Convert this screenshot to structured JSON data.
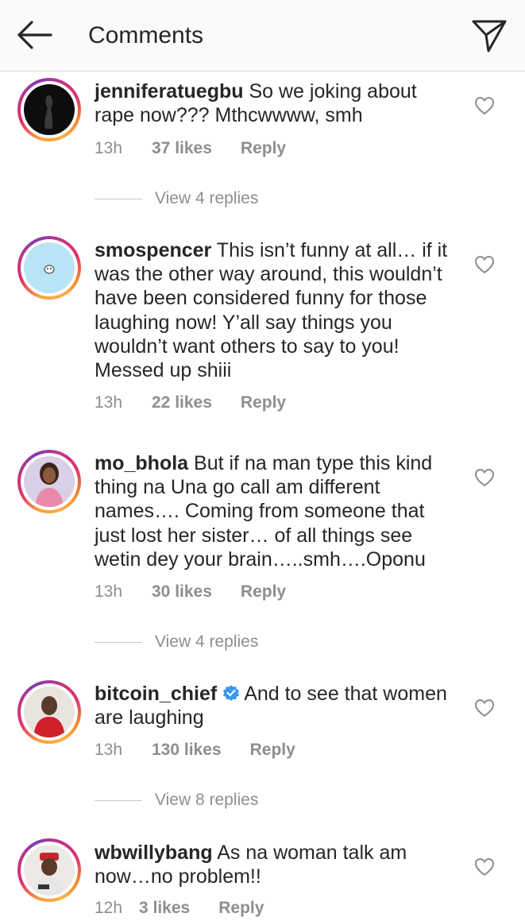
{
  "header": {
    "title": "Comments",
    "back_icon": "arrow-left-icon",
    "share_icon": "paper-plane-icon"
  },
  "colors": {
    "text": "#262626",
    "meta": "#8e8e8e",
    "verified": "#3897f0",
    "header_bg": "#fafafa"
  },
  "comments": [
    {
      "username": "jenniferatuegbu",
      "verified": false,
      "text": "So we joking about rape now??? Mthcwwww,  smh",
      "time": "13h",
      "likes": "37 likes",
      "reply": "Reply",
      "view_replies": "View 4 replies"
    },
    {
      "username": "smospencer",
      "verified": false,
      "text": "This isn’t funny at all… if it was the other way around, this wouldn’t have been considered funny for those laughing now! Y’all say things you wouldn’t want others to say to you! Messed up shiii",
      "time": "13h",
      "likes": "22 likes",
      "reply": "Reply",
      "view_replies": ""
    },
    {
      "username": "mo_bhola",
      "verified": false,
      "text": "But if na man type this kind thing na Una go call am different names…. Coming from someone that just lost her sister… of all things see wetin dey your brain…..smh….Oponu",
      "time": "13h",
      "likes": "30 likes",
      "reply": "Reply",
      "view_replies": "View 4 replies"
    },
    {
      "username": "bitcoin_chief",
      "verified": true,
      "text": "And to see that women are laughing",
      "time": "13h",
      "likes": "130 likes",
      "reply": "Reply",
      "view_replies": "View 8 replies"
    },
    {
      "username": "wbwillybang",
      "verified": false,
      "text": "As na woman talk am now…no problem!!",
      "time": "12h",
      "likes": "3 likes",
      "reply": "Reply",
      "view_replies": ""
    }
  ]
}
